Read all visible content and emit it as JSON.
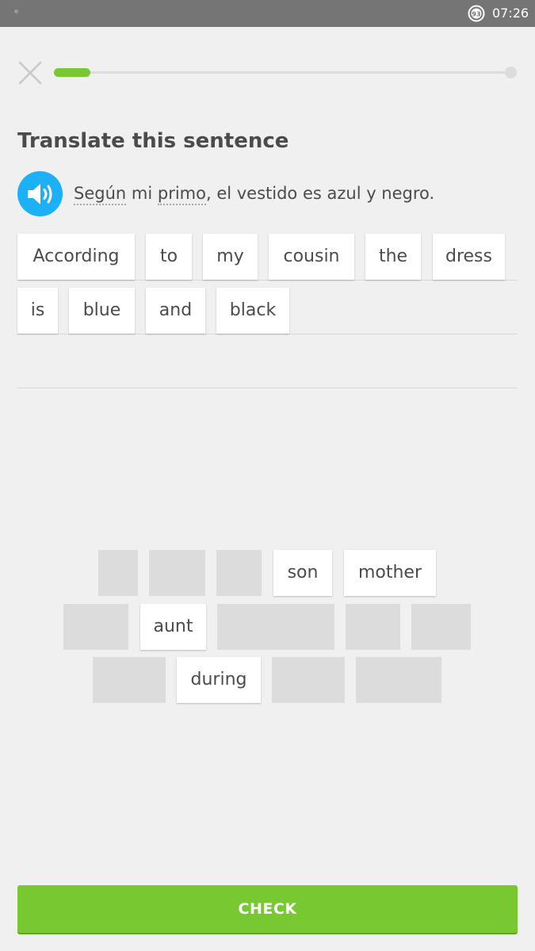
{
  "status_bar": {
    "time": "07:26",
    "battery_level": "93"
  },
  "header": {
    "progress_fraction": 0.08
  },
  "exercise": {
    "title": "Translate this sentence",
    "prompt_parts": [
      {
        "text": "Según",
        "hint": true
      },
      {
        "text": " mi ",
        "hint": false
      },
      {
        "text": "primo",
        "hint": true
      },
      {
        "text": ", el vestido es azul y negro.",
        "hint": false
      }
    ]
  },
  "answer": {
    "words": [
      "According",
      "to",
      "my",
      "cousin",
      "the",
      "dress",
      "is",
      "blue",
      "and",
      "black"
    ]
  },
  "word_bank": {
    "words": [
      "son",
      "mother",
      "aunt",
      "during"
    ]
  },
  "footer": {
    "check_label": "CHECK"
  },
  "colors": {
    "accent_green": "#78c832",
    "speaker_blue": "#1cb0f6",
    "text": "#4b4b4b",
    "background": "#f0f0f0"
  }
}
